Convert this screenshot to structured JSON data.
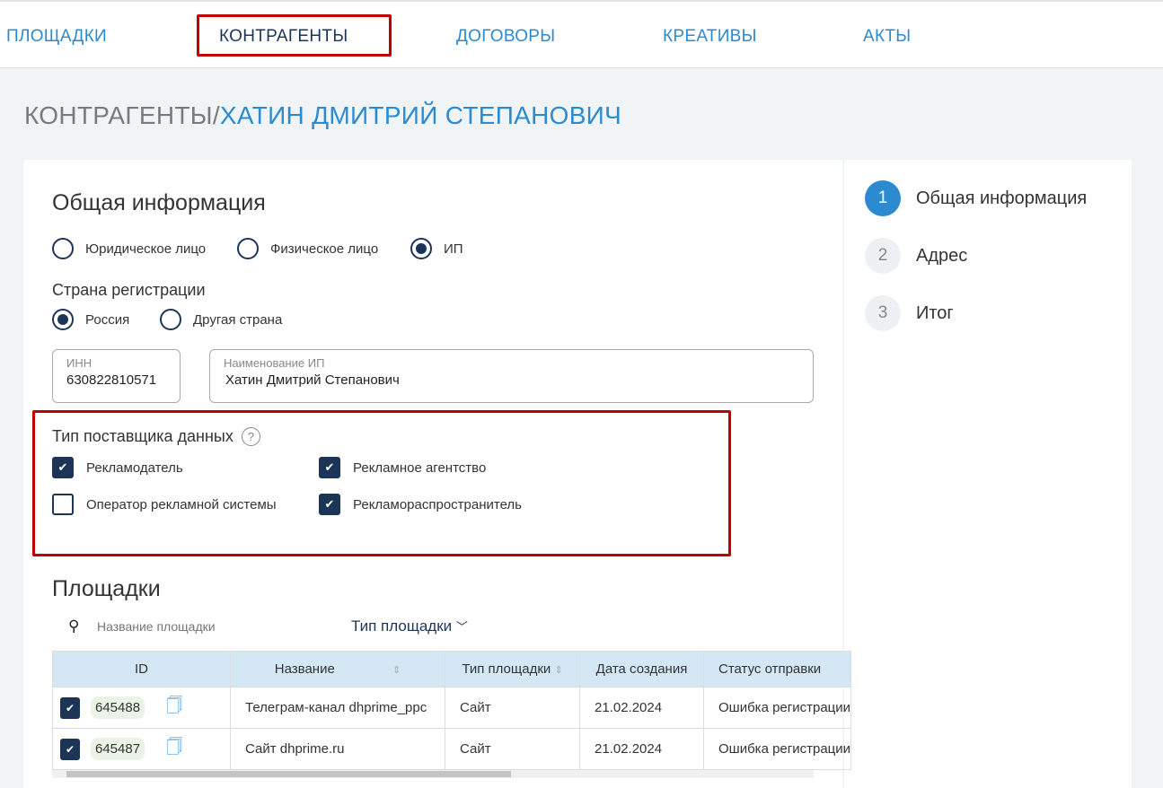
{
  "nav": [
    "ПЛОЩАДКИ",
    "КОНТРАГЕНТЫ",
    "ДОГОВОРЫ",
    "КРЕАТИВЫ",
    "АКТЫ"
  ],
  "breadcrumb": {
    "parent": "КОНТРАГЕНТЫ/",
    "current": "ХАТИН ДМИТРИЙ СТЕПАНОВИЧ"
  },
  "general": {
    "title": "Общая информация",
    "types": [
      "Юридическое лицо",
      "Физическое лицо",
      "ИП"
    ],
    "selected_type": "ИП",
    "country_label": "Страна регистрации",
    "countries": [
      "Россия",
      "Другая страна"
    ],
    "selected_country": "Россия",
    "inn_label": "ИНН",
    "inn_value": "630822810571",
    "name_label": "Наименование ИП",
    "name_value": "Хатин Дмитрий Степанович"
  },
  "provider": {
    "title": "Тип поставщика данных",
    "help_icon": "?",
    "options": [
      {
        "label": "Рекламодатель",
        "checked": true
      },
      {
        "label": "Рекламное агентство",
        "checked": true
      },
      {
        "label": "Оператор рекламной системы",
        "checked": false
      },
      {
        "label": "Рекламораспространитель",
        "checked": true
      }
    ]
  },
  "sites": {
    "title": "Площадки",
    "search_placeholder": "Название площадки",
    "filter_label": "Тип площадки",
    "columns": [
      "ID",
      "Название",
      "Тип площадки",
      "Дата создания",
      "Статус отправки"
    ],
    "rows": [
      {
        "id": "645488",
        "name": "Телеграм-канал dhprime_ppc",
        "type": "Сайт",
        "date": "21.02.2024",
        "status": "Ошибка регистрации"
      },
      {
        "id": "645487",
        "name": "Сайт dhprime.ru",
        "type": "Сайт",
        "date": "21.02.2024",
        "status": "Ошибка регистрации"
      }
    ]
  },
  "steps": [
    {
      "n": "1",
      "label": "Общая информация"
    },
    {
      "n": "2",
      "label": "Адрес"
    },
    {
      "n": "3",
      "label": "Итог"
    }
  ]
}
